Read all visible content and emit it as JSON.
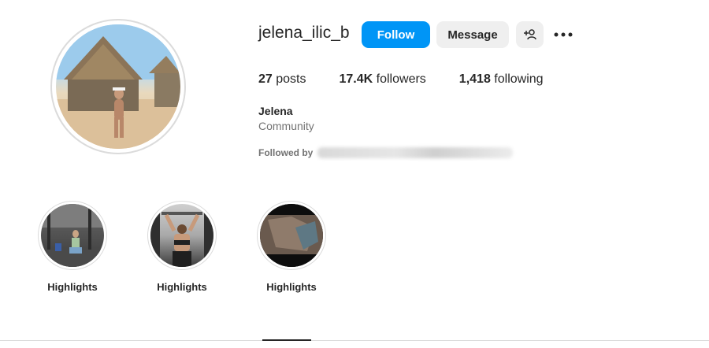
{
  "profile": {
    "username": "jelena_ilic_b",
    "full_name": "Jelena",
    "category": "Community",
    "followed_by_label": "Followed by",
    "avatar_desc": "profile-photo"
  },
  "actions": {
    "follow_label": "Follow",
    "message_label": "Message",
    "suggest_icon": "add-person-icon",
    "more_icon": "more-options-icon"
  },
  "stats": {
    "posts_count": "27",
    "posts_label": "posts",
    "followers_count": "17.4K",
    "followers_label": "followers",
    "following_count": "1,418",
    "following_label": "following"
  },
  "highlights": [
    {
      "label": "Highlights"
    },
    {
      "label": "Highlights"
    },
    {
      "label": "Highlights"
    }
  ],
  "colors": {
    "accent": "#0095f6",
    "text": "#262626",
    "secondary_text": "#737373",
    "button_gray": "#efefef"
  }
}
